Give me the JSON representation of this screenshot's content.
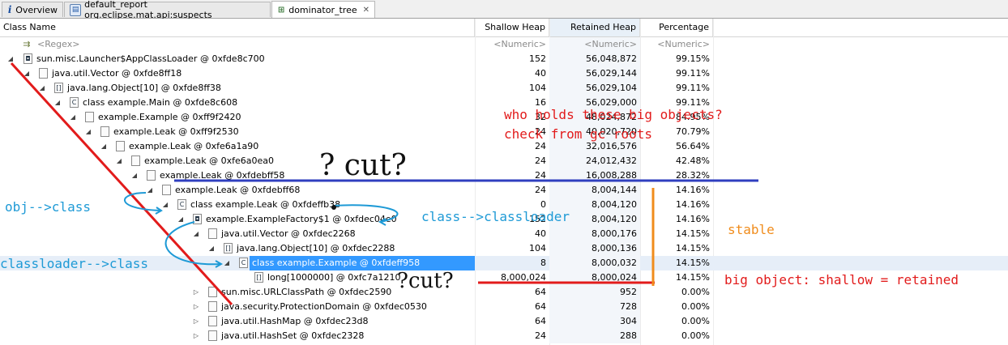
{
  "tabs": [
    {
      "label": "Overview",
      "icon": "info-icon"
    },
    {
      "label": "default_report  org.eclipse.mat.api:suspects",
      "icon": "report-icon"
    },
    {
      "label": "dominator_tree",
      "icon": "tree-icon",
      "close": "✕"
    }
  ],
  "columns": {
    "class_name": "Class Name",
    "shallow": "Shallow Heap",
    "retained": "Retained Heap",
    "percentage": "Percentage"
  },
  "filter_row": {
    "regex": "<Regex>",
    "shallow": "<Numeric>",
    "retained": "<Numeric>",
    "percentage": "<Numeric>"
  },
  "rows": [
    {
      "name": "sun.misc.Launcher$AppClassLoader @ 0xfde8c700",
      "shallow": "152",
      "retained": "56,048,872",
      "pct": "99.15%"
    },
    {
      "name": "java.util.Vector @ 0xfde8ff18",
      "shallow": "40",
      "retained": "56,029,144",
      "pct": "99.11%"
    },
    {
      "name": "java.lang.Object[10] @ 0xfde8ff38",
      "shallow": "104",
      "retained": "56,029,104",
      "pct": "99.11%"
    },
    {
      "name": "class example.Main @ 0xfde8c608",
      "shallow": "16",
      "retained": "56,029,000",
      "pct": "99.11%"
    },
    {
      "name": "example.Example @ 0xff9f2420",
      "shallow": "32",
      "retained": "48,024,872",
      "pct": "84.95%"
    },
    {
      "name": "example.Leak @ 0xff9f2530",
      "shallow": "24",
      "retained": "40,020,720",
      "pct": "70.79%"
    },
    {
      "name": "example.Leak @ 0xfe6a1a90",
      "shallow": "24",
      "retained": "32,016,576",
      "pct": "56.64%"
    },
    {
      "name": "example.Leak @ 0xfe6a0ea0",
      "shallow": "24",
      "retained": "24,012,432",
      "pct": "42.48%"
    },
    {
      "name": "example.Leak @ 0xfdebff58",
      "shallow": "24",
      "retained": "16,008,288",
      "pct": "28.32%"
    },
    {
      "name": "example.Leak @ 0xfdebff68",
      "shallow": "24",
      "retained": "8,004,144",
      "pct": "14.16%"
    },
    {
      "name": "class example.Leak @ 0xfdeffb38",
      "shallow": "0",
      "retained": "8,004,120",
      "pct": "14.16%"
    },
    {
      "name": "example.ExampleFactory$1 @ 0xfdec04e0",
      "shallow": "152",
      "retained": "8,004,120",
      "pct": "14.16%"
    },
    {
      "name": "java.util.Vector @ 0xfdec2268",
      "shallow": "40",
      "retained": "8,000,176",
      "pct": "14.15%"
    },
    {
      "name": "java.lang.Object[10] @ 0xfdec2288",
      "shallow": "104",
      "retained": "8,000,136",
      "pct": "14.15%"
    },
    {
      "name": "class example.Example @ 0xfdeff958",
      "shallow": "8",
      "retained": "8,000,032",
      "pct": "14.15%"
    },
    {
      "name": "long[1000000] @ 0xfc7a1210",
      "shallow": "8,000,024",
      "retained": "8,000,024",
      "pct": "14.15%"
    },
    {
      "name": "sun.misc.URLClassPath @ 0xfdec2590",
      "shallow": "64",
      "retained": "952",
      "pct": "0.00%"
    },
    {
      "name": "java.security.ProtectionDomain @ 0xfdec0530",
      "shallow": "64",
      "retained": "728",
      "pct": "0.00%"
    },
    {
      "name": "java.util.HashMap @ 0xfdec23d8",
      "shallow": "64",
      "retained": "304",
      "pct": "0.00%"
    },
    {
      "name": "java.util.HashSet @ 0xfdec2328",
      "shallow": "24",
      "retained": "288",
      "pct": "0.00%"
    }
  ],
  "annotations": {
    "who_holds": "who holds these big objects?",
    "check_from": "check from gc roots",
    "cut_top": "? cut?",
    "cut_bottom": "?cut?",
    "obj_class": "obj-->class",
    "class_classloader": "class-->classloader",
    "classloader_class": "classloader-->class",
    "stable": "stable",
    "big_object": "big object: shallow = retained"
  },
  "colors": {
    "selection": "#3399ff",
    "annotation_red": "#e21b1b",
    "annotation_blue": "#2f3fbf",
    "annotation_cyan": "#1e9ad6",
    "annotation_orange": "#f08c1c"
  }
}
